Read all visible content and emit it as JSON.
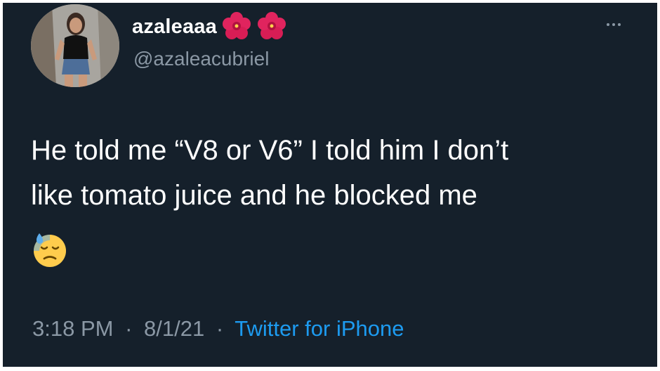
{
  "tweet": {
    "author": {
      "display_name": "azaleaaa",
      "name_emojis": [
        "hibiscus-emoji",
        "hibiscus-emoji"
      ],
      "handle": "@azaleacubriel",
      "avatar": "profile-photo"
    },
    "text_line_1": "He told me “V8 or V6” I told him I don’t",
    "text_line_2": "like tomato juice and he blocked me",
    "text_emoji": "downcast-face-with-sweat-emoji",
    "time": "3:18 PM",
    "separator": "·",
    "date": "8/1/21",
    "source": "Twitter for iPhone",
    "more_icon": "more-horizontal-icon"
  },
  "colors": {
    "background": "#15202b",
    "primary_text": "#ffffff",
    "secondary_text": "#8b98a5",
    "link": "#1d9bf0"
  }
}
